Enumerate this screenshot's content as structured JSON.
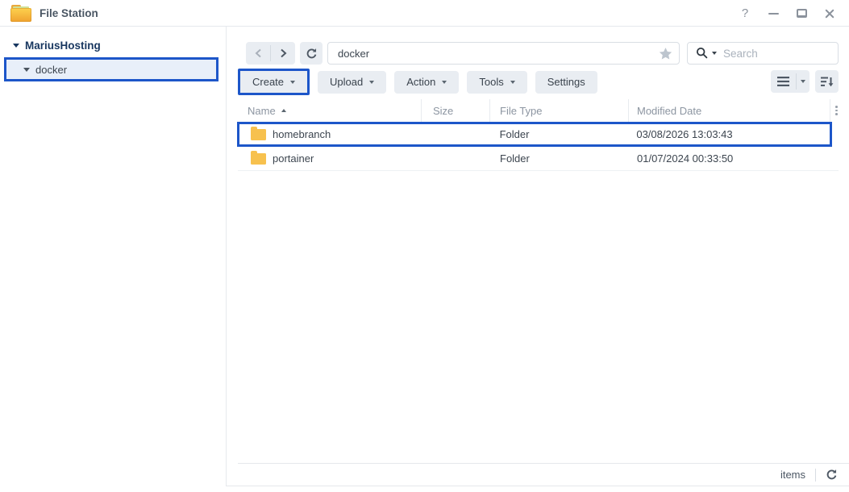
{
  "window": {
    "title": "File Station"
  },
  "sidebar": {
    "root_label": "MariusHosting",
    "selected_item": {
      "label": "docker"
    }
  },
  "nav": {
    "path_value": "docker",
    "search_placeholder": "Search"
  },
  "toolbar": {
    "buttons": [
      {
        "label": "Create",
        "dropdown": true,
        "highlighted": true
      },
      {
        "label": "Upload",
        "dropdown": true,
        "highlighted": false
      },
      {
        "label": "Action",
        "dropdown": true,
        "highlighted": false
      },
      {
        "label": "Tools",
        "dropdown": true,
        "highlighted": false
      },
      {
        "label": "Settings",
        "dropdown": false,
        "highlighted": false
      }
    ]
  },
  "table": {
    "columns": {
      "name": "Name",
      "size": "Size",
      "type": "File Type",
      "modified": "Modified Date"
    },
    "sort": {
      "column": "Name",
      "direction": "ascending"
    },
    "rows": [
      {
        "name": "homebranch",
        "size": "",
        "type": "Folder",
        "modified": "03/08/2026 13:03:43",
        "highlighted": true
      },
      {
        "name": "portainer",
        "size": "",
        "type": "Folder",
        "modified": "01/07/2024 00:33:50",
        "highlighted": false
      }
    ]
  },
  "statusbar": {
    "items_label": "items"
  },
  "colors": {
    "accent_blue": "#1d56c9",
    "folder_yellow": "#f7c14e"
  }
}
